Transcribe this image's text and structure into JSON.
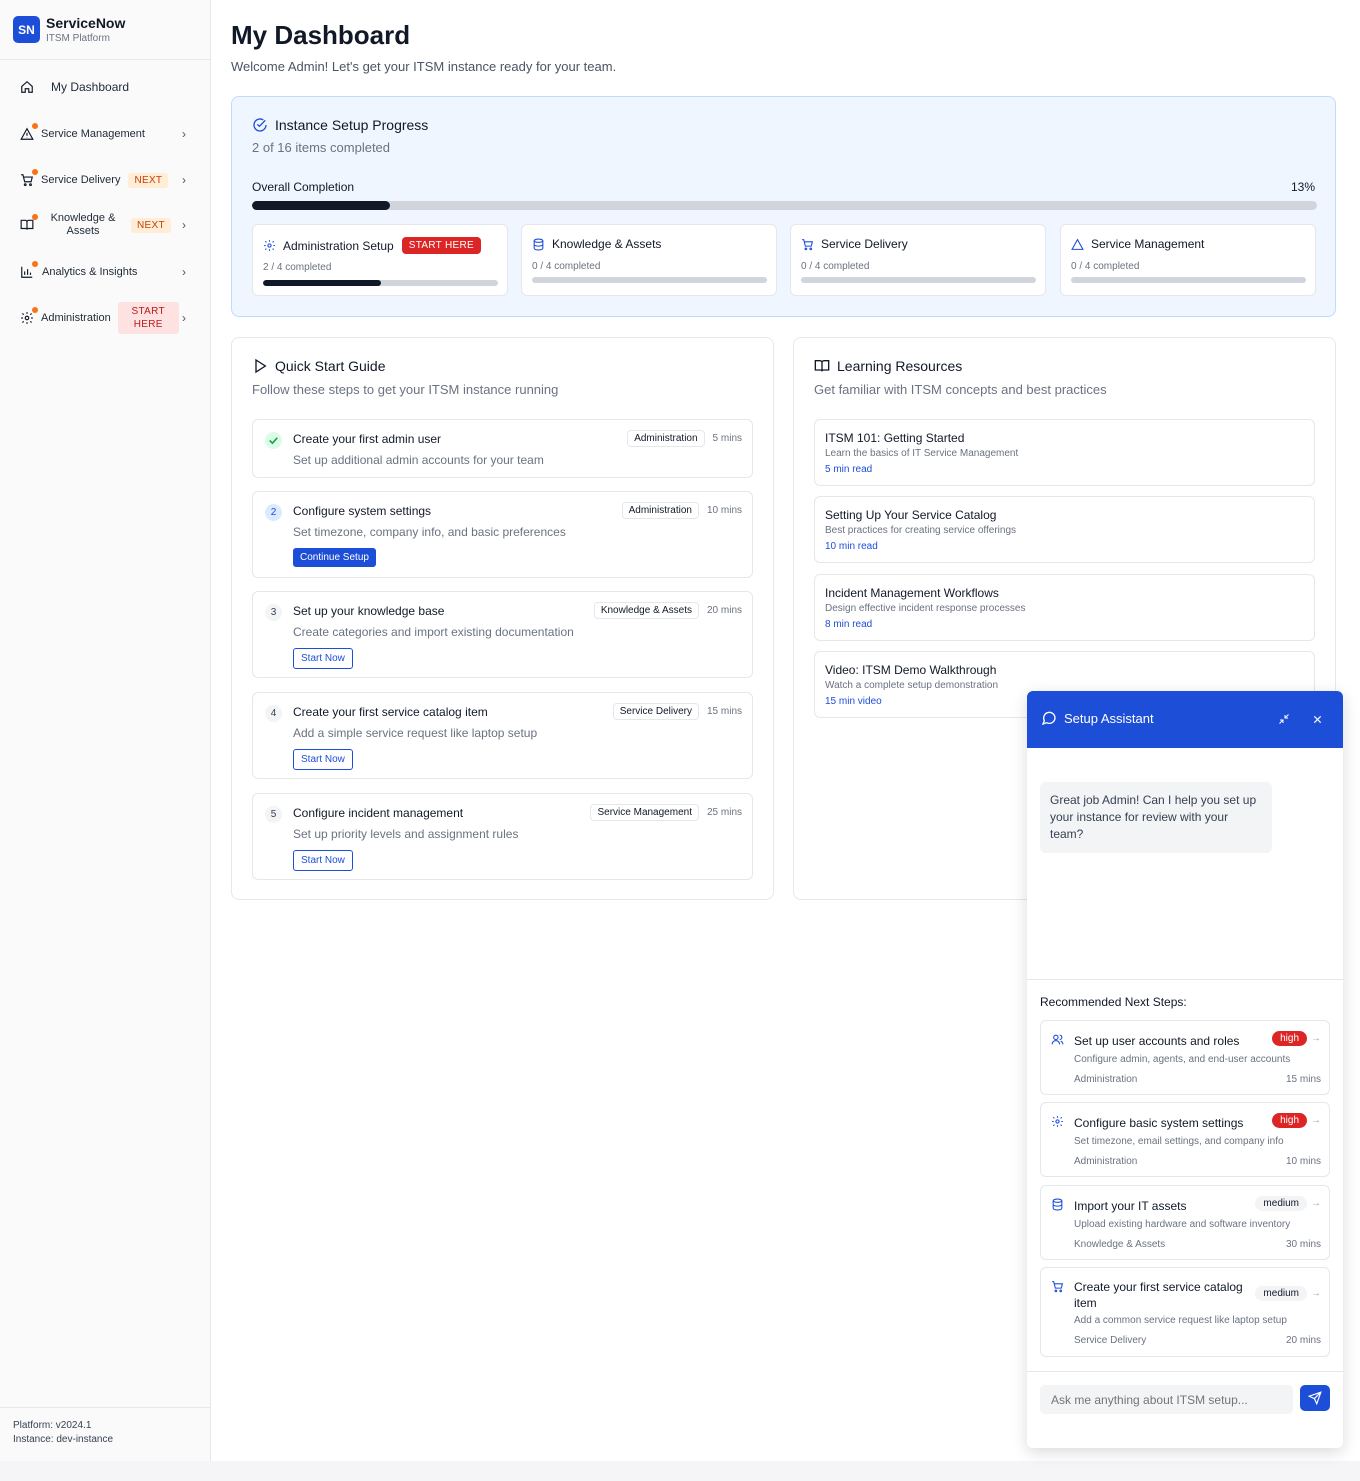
{
  "brand": {
    "logo": "SN",
    "title": "ServiceNow",
    "subtitle": "ITSM Platform"
  },
  "sidebar": {
    "items": [
      {
        "label": "My Dashboard",
        "icon": "home-icon"
      },
      {
        "label": "Service Management",
        "icon": "alert-triangle-icon"
      },
      {
        "label": "Service Delivery",
        "icon": "cart-icon",
        "badge": "NEXT"
      },
      {
        "label": "Knowledge & Assets",
        "icon": "book-icon",
        "badge": "NEXT"
      },
      {
        "label": "Analytics & Insights",
        "icon": "bar-chart-icon"
      },
      {
        "label": "Administration",
        "icon": "gear-icon",
        "badge": "START HERE"
      }
    ],
    "footer": {
      "platform": "Platform: v2024.1",
      "instance": "Instance: dev-instance"
    }
  },
  "main": {
    "title": "My Dashboard",
    "welcome": "Welcome Admin! Let's get your ITSM instance ready for your team."
  },
  "progress": {
    "title": "Instance Setup Progress",
    "subtitle": "2 of 16 items completed",
    "overall_label": "Overall Completion",
    "overall_pct_label": "13%",
    "overall_fraction": 0.13,
    "categories": [
      {
        "name": "Administration Setup",
        "badge": "START HERE",
        "count": "2 / 4 completed",
        "fraction": 0.5,
        "icon": "gear-icon"
      },
      {
        "name": "Knowledge & Assets",
        "count": "0 / 4 completed",
        "fraction": 0,
        "icon": "database-icon"
      },
      {
        "name": "Service Delivery",
        "count": "0 / 4 completed",
        "fraction": 0,
        "icon": "cart-icon"
      },
      {
        "name": "Service Management",
        "count": "0 / 4 completed",
        "fraction": 0,
        "icon": "alert-triangle-icon"
      }
    ]
  },
  "quickstart": {
    "title": "Quick Start Guide",
    "subtitle": "Follow these steps to get your ITSM instance running",
    "steps": [
      {
        "num": "",
        "status": "done",
        "title": "Create your first admin user",
        "desc": "Set up additional admin accounts for your team",
        "tag": "Administration",
        "time": "5 mins",
        "button": ""
      },
      {
        "num": "2",
        "status": "active",
        "title": "Configure system settings",
        "desc": "Set timezone, company info, and basic preferences",
        "tag": "Administration",
        "time": "10 mins",
        "button": "Continue Setup"
      },
      {
        "num": "3",
        "status": "todo",
        "title": "Set up your knowledge base",
        "desc": "Create categories and import existing documentation",
        "tag": "Knowledge & Assets",
        "time": "20 mins",
        "button": "Start Now"
      },
      {
        "num": "4",
        "status": "todo",
        "title": "Create your first service catalog item",
        "desc": "Add a simple service request like laptop setup",
        "tag": "Service Delivery",
        "time": "15 mins",
        "button": "Start Now"
      },
      {
        "num": "5",
        "status": "todo",
        "title": "Configure incident management",
        "desc": "Set up priority levels and assignment rules",
        "tag": "Service Management",
        "time": "25 mins",
        "button": "Start Now"
      }
    ]
  },
  "learning": {
    "title": "Learning Resources",
    "subtitle": "Get familiar with ITSM concepts and best practices",
    "items": [
      {
        "title": "ITSM 101: Getting Started",
        "desc": "Learn the basics of IT Service Management",
        "duration": "5 min read"
      },
      {
        "title": "Setting Up Your Service Catalog",
        "desc": "Best practices for creating service offerings",
        "duration": "10 min read"
      },
      {
        "title": "Incident Management Workflows",
        "desc": "Design effective incident response processes",
        "duration": "8 min read"
      },
      {
        "title": "Video: ITSM Demo Walkthrough",
        "desc": "Watch a complete setup demonstration",
        "duration": "15 min video"
      }
    ]
  },
  "assistant": {
    "title": "Setup Assistant",
    "message": "Great job Admin! Can I help you set up your instance for review with your team?",
    "rec_title": "Recommended Next Steps:",
    "recs": [
      {
        "title": "Set up user accounts and roles",
        "priority": "high",
        "desc": "Configure admin, agents, and end-user accounts",
        "category": "Administration",
        "time": "15 mins",
        "icon": "users-icon"
      },
      {
        "title": "Configure basic system settings",
        "priority": "high",
        "desc": "Set timezone, email settings, and company info",
        "category": "Administration",
        "time": "10 mins",
        "icon": "gear-icon"
      },
      {
        "title": "Import your IT assets",
        "priority": "medium",
        "desc": "Upload existing hardware and software inventory",
        "category": "Knowledge & Assets",
        "time": "30 mins",
        "icon": "database-icon"
      },
      {
        "title": "Create your first service catalog item",
        "priority": "medium",
        "desc": "Add a common service request like laptop setup",
        "category": "Service Delivery",
        "time": "20 mins",
        "icon": "cart-icon"
      }
    ],
    "input_placeholder": "Ask me anything about ITSM setup..."
  },
  "colors": {
    "accent": "#1d4ed8",
    "danger": "#dc2626",
    "warning": "#f97316"
  }
}
